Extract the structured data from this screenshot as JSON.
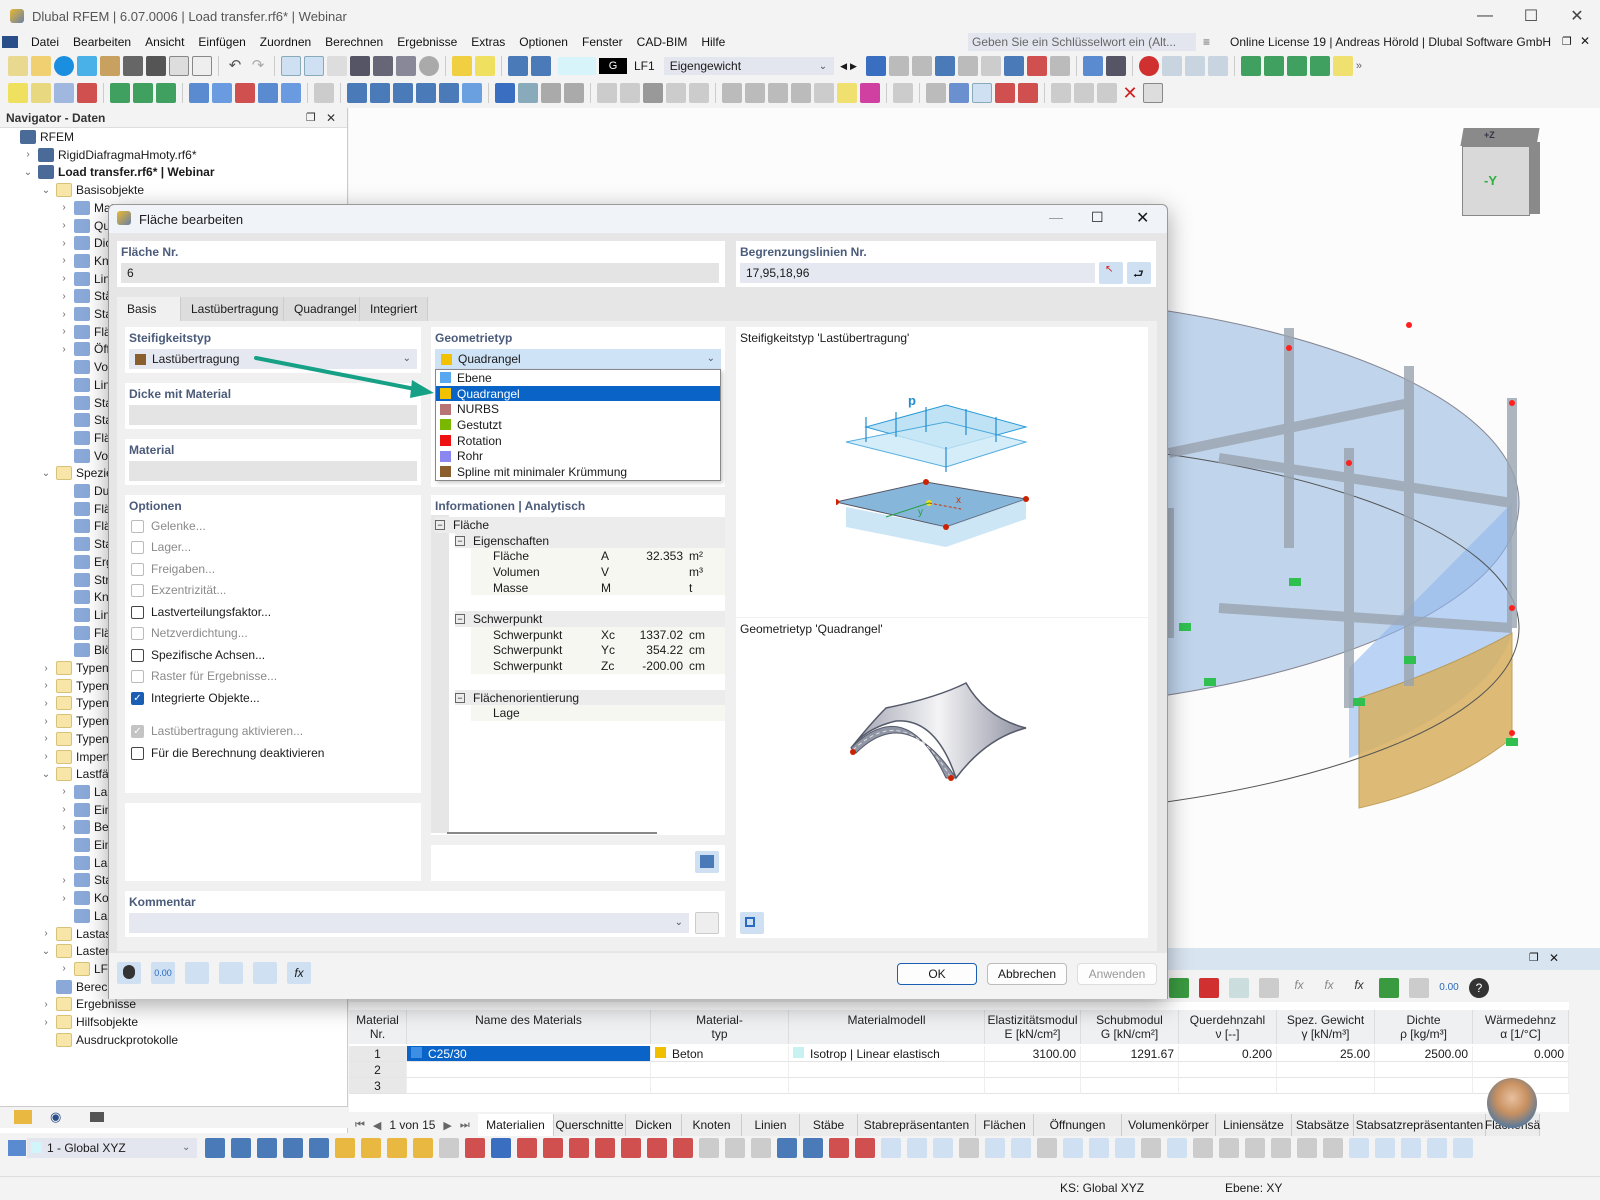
{
  "window": {
    "title": "Dlubal RFEM | 6.07.0006 | Load transfer.rf6* | Webinar",
    "minimize": "—",
    "maximize": "☐",
    "close": "✕"
  },
  "menu": [
    "Datei",
    "Bearbeiten",
    "Ansicht",
    "Einfügen",
    "Zuordnen",
    "Berechnen",
    "Ergebnisse",
    "Extras",
    "Optionen",
    "Fenster",
    "CAD-BIM",
    "Hilfe"
  ],
  "search": {
    "placeholder": "Geben Sie ein Schlüsselwort ein (Alt..."
  },
  "license": "Online License 19 | Andreas Hörold | Dlubal Software GmbH",
  "toolbar": {
    "loadcase_badge": "G",
    "loadcase_id": "LF1",
    "loadcase_name": "Eigengewicht"
  },
  "navigator": {
    "title": "Navigator - Daten",
    "items": [
      {
        "label": "RFEM",
        "level": 0,
        "tw": ""
      },
      {
        "label": "RigidDiafragmaHmoty.rf6*",
        "level": 1,
        "tw": ">"
      },
      {
        "label": "Load transfer.rf6* | Webinar",
        "level": 1,
        "tw": "v",
        "bold": true
      },
      {
        "label": "Basisobjekte",
        "level": 2,
        "tw": "v",
        "folder": true
      },
      {
        "label": "Mat",
        "level": 3,
        "tw": ">"
      },
      {
        "label": "Que",
        "level": 3,
        "tw": ">"
      },
      {
        "label": "Dick",
        "level": 3,
        "tw": ">"
      },
      {
        "label": "Kno",
        "level": 3,
        "tw": ">"
      },
      {
        "label": "Linie",
        "level": 3,
        "tw": ">"
      },
      {
        "label": "Stäb",
        "level": 3,
        "tw": ">"
      },
      {
        "label": "Stab",
        "level": 3,
        "tw": ">"
      },
      {
        "label": "Fläc",
        "level": 3,
        "tw": ">"
      },
      {
        "label": "Öffr",
        "level": 3,
        "tw": ">"
      },
      {
        "label": "Volu",
        "level": 3,
        "tw": ""
      },
      {
        "label": "Linie",
        "level": 3,
        "tw": ""
      },
      {
        "label": "Stab",
        "level": 3,
        "tw": ""
      },
      {
        "label": "Stab",
        "level": 3,
        "tw": ""
      },
      {
        "label": "Fläc",
        "level": 3,
        "tw": ""
      },
      {
        "label": "Volu",
        "level": 3,
        "tw": ""
      },
      {
        "label": "Speziell",
        "level": 2,
        "tw": "v",
        "folder": true
      },
      {
        "label": "Durc",
        "level": 3,
        "tw": ""
      },
      {
        "label": "Fläc",
        "level": 3,
        "tw": ""
      },
      {
        "label": "Fläc",
        "level": 3,
        "tw": ""
      },
      {
        "label": "Star",
        "level": 3,
        "tw": ""
      },
      {
        "label": "Erge",
        "level": 3,
        "tw": ""
      },
      {
        "label": "Stru",
        "level": 3,
        "tw": ""
      },
      {
        "label": "Knot",
        "level": 3,
        "tw": ""
      },
      {
        "label": "Linie",
        "level": 3,
        "tw": ""
      },
      {
        "label": "Fläc",
        "level": 3,
        "tw": ""
      },
      {
        "label": "Blöc",
        "level": 3,
        "tw": ""
      },
      {
        "label": "Typen fü",
        "level": 2,
        "tw": ">",
        "folder": true
      },
      {
        "label": "Typen fü",
        "level": 2,
        "tw": ">",
        "folder": true
      },
      {
        "label": "Typen fü",
        "level": 2,
        "tw": ">",
        "folder": true
      },
      {
        "label": "Typen fü",
        "level": 2,
        "tw": ">",
        "folder": true
      },
      {
        "label": "Typen fü",
        "level": 2,
        "tw": ">",
        "folder": true
      },
      {
        "label": "Imperfel",
        "level": 2,
        "tw": ">",
        "folder": true
      },
      {
        "label": "Lastfälle",
        "level": 2,
        "tw": "v",
        "folder": true
      },
      {
        "label": "Last",
        "level": 3,
        "tw": ">"
      },
      {
        "label": "Einv",
        "level": 3,
        "tw": ">"
      },
      {
        "label": "Bem",
        "level": 3,
        "tw": ">"
      },
      {
        "label": "Einv",
        "level": 3,
        "tw": ""
      },
      {
        "label": "Last",
        "level": 3,
        "tw": ""
      },
      {
        "label": "Stat",
        "level": 3,
        "tw": ">"
      },
      {
        "label": "Kom",
        "level": 3,
        "tw": ">"
      },
      {
        "label": "Last",
        "level": 3,
        "tw": ""
      },
      {
        "label": "Lastassis",
        "level": 2,
        "tw": ">",
        "folder": true
      },
      {
        "label": "Lasten",
        "level": 2,
        "tw": "v",
        "folder": true
      },
      {
        "label": "LF1",
        "level": 3,
        "tw": ">",
        "folder": true
      },
      {
        "label": "Berechnungsdiagramme",
        "level": 2,
        "tw": ""
      },
      {
        "label": "Ergebnisse",
        "level": 2,
        "tw": ">",
        "folder": true
      },
      {
        "label": "Hilfsobjekte",
        "level": 2,
        "tw": ">",
        "folder": true
      },
      {
        "label": "Ausdruckprotokolle",
        "level": 2,
        "tw": "",
        "folder": true
      }
    ],
    "coord_system": "1 - Global XYZ"
  },
  "dialog": {
    "title": "Fläche bearbeiten",
    "surface_no_label": "Fläche Nr.",
    "surface_no": "6",
    "boundary_label": "Begrenzungslinien Nr.",
    "boundary_value": "17,95,18,96",
    "tabs": [
      "Basis",
      "Lastübertragung",
      "Quadrangel",
      "Integriert"
    ],
    "stiffness_label": "Steifigkeitstyp",
    "stiffness_value": "Lastübertragung",
    "stiffness_color": "#8b5e2e",
    "thickness_label": "Dicke mit Material",
    "material_label": "Material",
    "geometry_label": "Geometrietyp",
    "geometry_value": "Quadrangel",
    "geometry_options": [
      {
        "label": "Ebene",
        "color": "#5aa9f0"
      },
      {
        "label": "Quadrangel",
        "color": "#f2c200",
        "selected": true
      },
      {
        "label": "NURBS",
        "color": "#b87474"
      },
      {
        "label": "Gestutzt",
        "color": "#7ab800"
      },
      {
        "label": "Rotation",
        "color": "#ee1111"
      },
      {
        "label": "Rohr",
        "color": "#8a88f0"
      },
      {
        "label": "Spline mit minimaler Krümmung",
        "color": "#8b5e2e"
      }
    ],
    "options_label": "Optionen",
    "options": [
      {
        "label": "Gelenke...",
        "state": "disabled"
      },
      {
        "label": "Lager...",
        "state": "disabled"
      },
      {
        "label": "Freigaben...",
        "state": "disabled"
      },
      {
        "label": "Exzentrizität...",
        "state": "disabled"
      },
      {
        "label": "Lastverteilungsfaktor...",
        "state": "off"
      },
      {
        "label": "Netzverdichtung...",
        "state": "disabled"
      },
      {
        "label": "Spezifische Achsen...",
        "state": "off"
      },
      {
        "label": "Raster für Ergebnisse...",
        "state": "disabled"
      },
      {
        "label": "Integrierte Objekte...",
        "state": "on"
      },
      {
        "label": "Lastübertragung aktivieren...",
        "state": "on-disabled"
      },
      {
        "label": "Für die Berechnung deaktivieren",
        "state": "off"
      }
    ],
    "info_label": "Informationen | Analytisch",
    "info": {
      "root": "Fläche",
      "props_header": "Eigenschaften",
      "props": [
        {
          "name": "Fläche",
          "sym": "A",
          "val": "32.353",
          "unit": "m²"
        },
        {
          "name": "Volumen",
          "sym": "V",
          "val": "",
          "unit": "m³"
        },
        {
          "name": "Masse",
          "sym": "M",
          "val": "",
          "unit": "t"
        }
      ],
      "cog_header": "Schwerpunkt",
      "cog": [
        {
          "name": "Schwerpunkt",
          "sym": "Xc",
          "val": "1337.02",
          "unit": "cm"
        },
        {
          "name": "Schwerpunkt",
          "sym": "Yc",
          "val": "354.22",
          "unit": "cm"
        },
        {
          "name": "Schwerpunkt",
          "sym": "Zc",
          "val": "-200.00",
          "unit": "cm"
        }
      ],
      "orient_header": "Flächenorientierung",
      "orient": [
        {
          "name": "Lage",
          "sym": "",
          "val": "",
          "unit": ""
        }
      ]
    },
    "preview1_title": "Steifigkeitstyp 'Lastübertragung'",
    "preview1_load_label": "p",
    "preview1_axes": {
      "x": "x",
      "y": "y"
    },
    "preview2_title": "Geometrietyp 'Quadrangel'",
    "comment_label": "Kommentar",
    "buttons": {
      "ok": "OK",
      "cancel": "Abbrechen",
      "apply": "Anwenden"
    }
  },
  "viewcube": {
    "top": "+Z",
    "front": "-Y"
  },
  "table": {
    "headers": [
      [
        "Material",
        "Nr."
      ],
      [
        "",
        "Name des Materials"
      ],
      [
        "Material-",
        "typ"
      ],
      [
        "",
        "Materialmodell"
      ],
      [
        "Elastizitätsmodul",
        "E [kN/cm²]"
      ],
      [
        "Schubmodul",
        "G [kN/cm²]"
      ],
      [
        "Querdehnzahl",
        "ν [--]"
      ],
      [
        "Spez. Gewicht",
        "γ [kN/m³]"
      ],
      [
        "Dichte",
        "ρ [kg/m³]"
      ],
      [
        "Wärmedehnz",
        "α [1/°C]"
      ]
    ],
    "rows": [
      {
        "nr": "1",
        "name": "C25/30",
        "name_color": "#3d8fe6",
        "type": "Beton",
        "type_color": "#f0c000",
        "model": "Isotrop | Linear elastisch",
        "model_color": "#c8f2f2",
        "E": "3100.00",
        "G": "1291.67",
        "nu": "0.200",
        "gamma": "25.00",
        "rho": "2500.00",
        "alpha": "0.000"
      },
      {
        "nr": "2"
      },
      {
        "nr": "3"
      }
    ],
    "pager": "1 von 15",
    "tabs": [
      "Materialien",
      "Querschnitte",
      "Dicken",
      "Knoten",
      "Linien",
      "Stäbe",
      "Stabrepräsentanten",
      "Flächen",
      "Öffnungen",
      "Volumenkörper",
      "Liniensätze",
      "Stabsätze",
      "Stabsatzrepräsentanten",
      "Flächensä"
    ]
  },
  "status": {
    "cs": "KS: Global XYZ",
    "plane": "Ebene: XY"
  }
}
